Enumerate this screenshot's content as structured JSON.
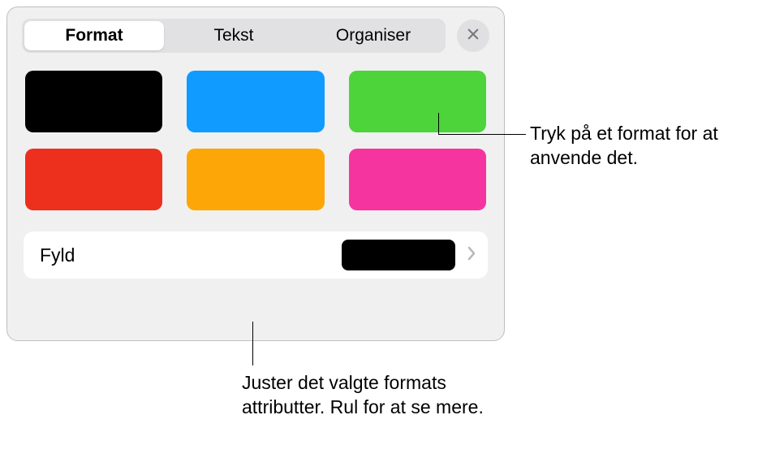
{
  "tabs": {
    "items": [
      {
        "label": "Format",
        "active": true
      },
      {
        "label": "Tekst",
        "active": false
      },
      {
        "label": "Organiser",
        "active": false
      }
    ]
  },
  "swatches": [
    {
      "color": "#000000"
    },
    {
      "color": "#0f9bff"
    },
    {
      "color": "#4cd43a"
    },
    {
      "color": "#ed2f1e"
    },
    {
      "color": "#fca707"
    },
    {
      "color": "#f6349f"
    }
  ],
  "fill": {
    "label": "Fyld",
    "previewColor": "#000000"
  },
  "callouts": {
    "c1": "Tryk på et format for at anvende det.",
    "c2": "Juster det valgte formats attributter. Rul for at se mere."
  }
}
